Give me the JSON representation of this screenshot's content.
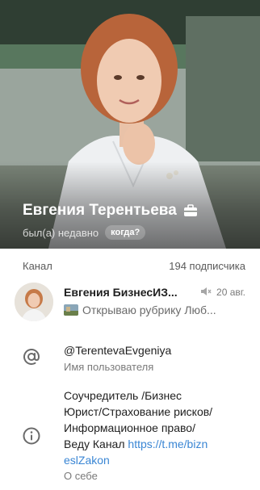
{
  "profile": {
    "name": "Евгения Терентьева",
    "last_seen": "был(а) недавно",
    "when_button": "когда?"
  },
  "channel_section": {
    "label": "Канал",
    "subscribers": "194 подписчика"
  },
  "channel": {
    "name": "Евгения БизнесИЗ...",
    "date": "20 авг.",
    "preview": "Открываю рубрику Люб..."
  },
  "username": {
    "value": "@TerentevaEvgeniya",
    "label": "Имя пользователя"
  },
  "about": {
    "line1": "Соучредитель /Бизнес",
    "line2": "Юрист/Страхование рисков/",
    "line3": "Информационное право/",
    "line4_text": "Веду Канал ",
    "line4_link": "https://t.me/bizn",
    "line5_link": "eslZakon",
    "label": "О себе"
  },
  "colors": {
    "link": "#3a86d4",
    "icon": "#6b6b6b"
  }
}
